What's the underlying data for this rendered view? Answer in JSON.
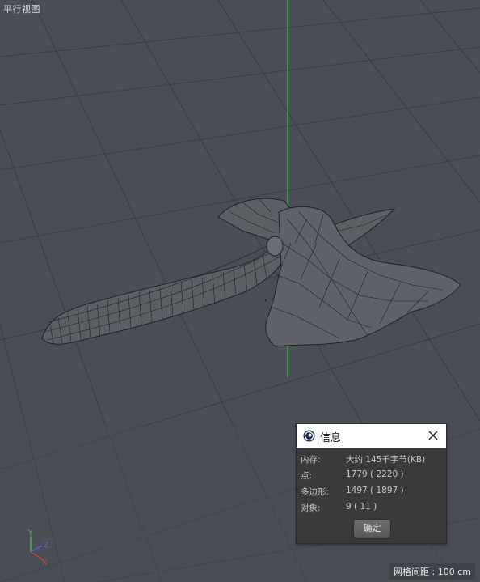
{
  "viewport": {
    "view_label": "平行视图",
    "grid_spacing": "网格间距 : 100 cm"
  },
  "axis_gizmo": {
    "y_label": "Y",
    "z_label": "Z",
    "x_label": "X"
  },
  "info_dialog": {
    "title": "信息",
    "rows": [
      {
        "label": "内存:",
        "value": "大约 145千字节(KB)"
      },
      {
        "label": "点:",
        "value": "1779 ( 2220 )"
      },
      {
        "label": "多边形:",
        "value": "1497 ( 1897 )"
      },
      {
        "label": "对象:",
        "value": "9 ( 11 )"
      }
    ],
    "ok_label": "确定"
  },
  "colors": {
    "background": "#4a4e57",
    "grid_line": "#3a3d44",
    "y_axis_line": "#3fbf3f",
    "mesh_fill": "#5c5f66",
    "mesh_wire": "#1e1f22"
  },
  "icons": {
    "app": "cinema4d-logo-icon",
    "close": "close-icon"
  }
}
